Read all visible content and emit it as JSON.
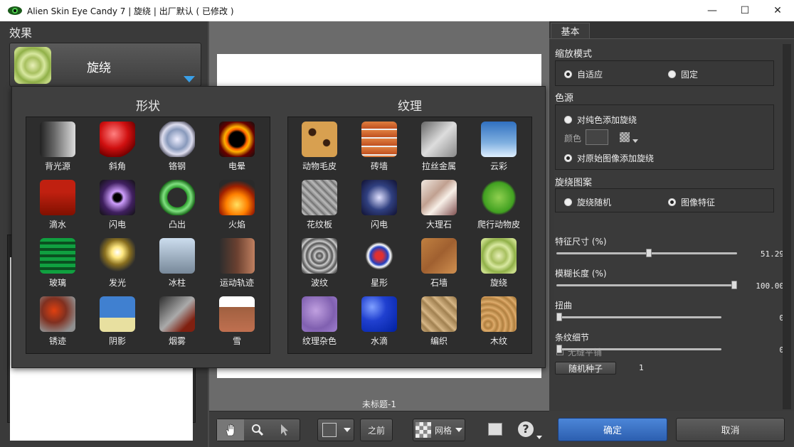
{
  "window": {
    "title": "Alien Skin Eye Candy 7 | 旋绕 | 出厂默认 ( 已修改 )",
    "minimize": "—",
    "maximize": "☐",
    "close": "✕"
  },
  "left": {
    "effects_label": "效果",
    "selected_effect": "旋绕"
  },
  "popup": {
    "shapes_title": "形状",
    "textures_title": "纹理",
    "shapes": [
      {
        "label": "背光源",
        "icon": "backlight-icon"
      },
      {
        "label": "斜角",
        "icon": "bevel-icon"
      },
      {
        "label": "铬钢",
        "icon": "chrome-icon"
      },
      {
        "label": "电晕",
        "icon": "corona-icon"
      },
      {
        "label": "滴水",
        "icon": "drip-icon"
      },
      {
        "label": "闪电",
        "icon": "lightning-icon"
      },
      {
        "label": "凸出",
        "icon": "extrude-icon"
      },
      {
        "label": "火焰",
        "icon": "fire-icon"
      },
      {
        "label": "玻璃",
        "icon": "glass-icon"
      },
      {
        "label": "发光",
        "icon": "glow-icon"
      },
      {
        "label": "冰柱",
        "icon": "icicles-icon"
      },
      {
        "label": "运动轨迹",
        "icon": "motion-trail-icon"
      },
      {
        "label": "锈迹",
        "icon": "rust-icon"
      },
      {
        "label": "阴影",
        "icon": "shadow-icon"
      },
      {
        "label": "烟雾",
        "icon": "smoke-icon"
      },
      {
        "label": "雪",
        "icon": "snow-icon"
      }
    ],
    "textures": [
      {
        "label": "动物毛皮",
        "icon": "animal-fur-icon"
      },
      {
        "label": "砖墙",
        "icon": "brick-wall-icon"
      },
      {
        "label": "拉丝金属",
        "icon": "brushed-metal-icon"
      },
      {
        "label": "云彩",
        "icon": "clouds-icon"
      },
      {
        "label": "花纹板",
        "icon": "diamond-plate-icon"
      },
      {
        "label": "闪电",
        "icon": "lightning-texture-icon"
      },
      {
        "label": "大理石",
        "icon": "marble-icon"
      },
      {
        "label": "爬行动物皮",
        "icon": "reptile-skin-icon"
      },
      {
        "label": "波纹",
        "icon": "ripples-icon"
      },
      {
        "label": "星形",
        "icon": "star-icon"
      },
      {
        "label": "石墙",
        "icon": "stone-wall-icon"
      },
      {
        "label": "旋绕",
        "icon": "swirl-icon"
      },
      {
        "label": "纹理杂色",
        "icon": "texture-noise-icon"
      },
      {
        "label": "水滴",
        "icon": "water-drops-icon"
      },
      {
        "label": "编织",
        "icon": "weave-icon"
      },
      {
        "label": "木纹",
        "icon": "wood-icon"
      }
    ]
  },
  "center": {
    "doc_title": "未标题-1",
    "before_label": "之前",
    "grid_label": "网格"
  },
  "right": {
    "tab": "基本",
    "scale_mode": {
      "label": "缩放模式",
      "opt1": "自适应",
      "opt2": "固定",
      "selected": "自适应"
    },
    "color_source": {
      "label": "色源",
      "opt1": "对纯色添加旋绕",
      "color_label": "颜色",
      "opt2": "对原始图像添加旋绕",
      "selected": "对原始图像添加旋绕"
    },
    "swirl_pattern": {
      "label": "旋绕图案",
      "opt1": "旋绕随机",
      "opt2": "图像特征",
      "selected": "图像特征"
    },
    "sliders": [
      {
        "label": "特征尺寸 (%)",
        "value": "51.29",
        "fraction": 0.5129
      },
      {
        "label": "模糊长度 (%)",
        "value": "100.00",
        "fraction": 1.0
      },
      {
        "label": "扭曲",
        "value": "0",
        "fraction": 0
      },
      {
        "label": "条纹细节",
        "value": "0",
        "fraction": 0
      }
    ],
    "seamless_label": "无缝平铺",
    "random_seed_button": "随机种子",
    "random_seed_value": "1",
    "ok": "确定",
    "cancel": "取消"
  },
  "colors": {
    "accent": "#3aa0e8",
    "ok_button": "#3a74c8"
  }
}
